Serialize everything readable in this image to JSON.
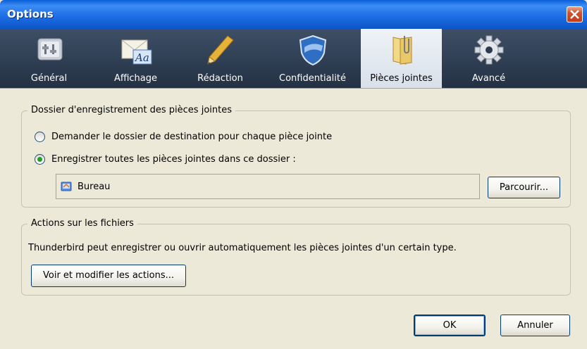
{
  "window": {
    "title": "Options"
  },
  "tabs": [
    {
      "label": "Général",
      "icon": "general-icon"
    },
    {
      "label": "Affichage",
      "icon": "display-icon",
      "glyph": "Aa"
    },
    {
      "label": "Rédaction",
      "icon": "pencil-icon"
    },
    {
      "label": "Confidentialité",
      "icon": "shield-icon"
    },
    {
      "label": "Pièces jointes",
      "icon": "paperclip-folder-icon",
      "selected": true
    },
    {
      "label": "Avancé",
      "icon": "gear-icon"
    }
  ],
  "attachments_folder": {
    "title": "Dossier d'enregistrement des pièces jointes",
    "option_ask": "Demander le dossier de destination pour chaque pièce jointe",
    "option_save": "Enregistrer toutes les pièces jointes dans ce dossier :",
    "selected_option": "save",
    "folder_name": "Bureau",
    "browse_label": "Parcourir..."
  },
  "file_actions": {
    "title": "Actions sur les fichiers",
    "description": "Thunderbird peut enregistrer ou ouvrir automatiquement les pièces jointes d'un certain type.",
    "button_label": "Voir et modifier les actions..."
  },
  "footer": {
    "ok_label": "OK",
    "cancel_label": "Annuler"
  },
  "colors": {
    "titlebar": "#0A5FD8",
    "toolbar": "#2B3A4E",
    "dialog_bg": "#ECE9D8",
    "close": "#D4512C"
  }
}
